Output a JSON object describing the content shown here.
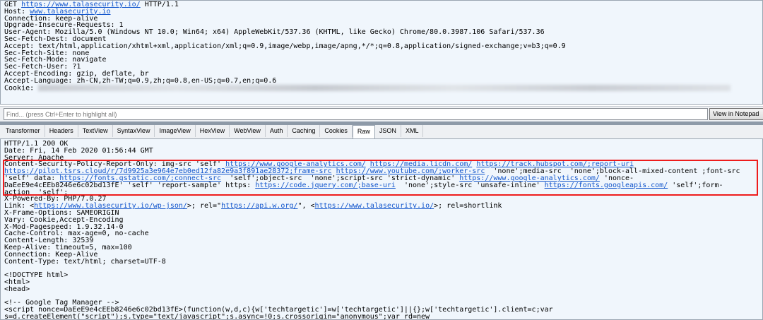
{
  "request": {
    "lines": [
      [
        {
          "t": "GET "
        },
        {
          "t": "https://www.talasecurity.io/",
          "link": true
        },
        {
          "t": " HTTP/1.1"
        }
      ],
      [
        {
          "t": "Host: "
        },
        {
          "t": "www.talasecurity.io",
          "link": true
        }
      ],
      [
        {
          "t": "Connection: keep-alive"
        }
      ],
      [
        {
          "t": "Upgrade-Insecure-Requests: 1"
        }
      ],
      [
        {
          "t": "User-Agent: Mozilla/5.0 (Windows NT 10.0; Win64; x64) AppleWebKit/537.36 (KHTML, like Gecko) Chrome/80.0.3987.106 Safari/537.36"
        }
      ],
      [
        {
          "t": "Sec-Fetch-Dest: document"
        }
      ],
      [
        {
          "t": "Accept: text/html,application/xhtml+xml,application/xml;q=0.9,image/webp,image/apng,*/*;q=0.8,application/signed-exchange;v=b3;q=0.9"
        }
      ],
      [
        {
          "t": "Sec-Fetch-Site: none"
        }
      ],
      [
        {
          "t": "Sec-Fetch-Mode: navigate"
        }
      ],
      [
        {
          "t": "Sec-Fetch-User: ?1"
        }
      ],
      [
        {
          "t": "Accept-Encoding: gzip, deflate, br"
        }
      ],
      [
        {
          "t": "Accept-Language: zh-CN,zh-TW;q=0.9,zh;q=0.8,en-US;q=0.7,en;q=0.6"
        }
      ],
      [
        {
          "t": "Cookie: "
        },
        {
          "blur": true
        }
      ]
    ]
  },
  "find": {
    "placeholder": "Find... (press Ctrl+Enter to highlight all)",
    "view_notepad": "View in Notepad"
  },
  "tabs": [
    "Transformer",
    "Headers",
    "TextView",
    "SyntaxView",
    "ImageView",
    "HexView",
    "WebView",
    "Auth",
    "Caching",
    "Cookies",
    "Raw",
    "JSON",
    "XML"
  ],
  "active_tab": "Raw",
  "response": {
    "lines": [
      [
        {
          "t": "HTTP/1.1 200 OK"
        }
      ],
      [
        {
          "t": "Date: Fri, 14 Feb 2020 01:56:44 GMT"
        }
      ],
      [
        {
          "t": "Server: Apache"
        }
      ],
      [
        {
          "t": "Content-Security-Policy-Report-Only: img-src 'self' "
        },
        {
          "t": "https://www.google-analytics.com/",
          "link": true
        },
        {
          "t": " "
        },
        {
          "t": "https://media.licdn.com/",
          "link": true
        },
        {
          "t": " "
        },
        {
          "t": "https://track.hubspot.com/;report-uri",
          "link": true
        }
      ],
      [
        {
          "t": "https://pilot.tsrs.cloud/r/7d9925a3e964e7eb0ed12fa82e9a3f891ae28372;frame-src",
          "link": true
        },
        {
          "t": " "
        },
        {
          "t": "https://www.youtube.com/;worker-src",
          "link": true
        },
        {
          "t": "  'none';media-src  'none';block-all-mixed-content ;font-src"
        }
      ],
      [
        {
          "t": "'self' data: "
        },
        {
          "t": "https://fonts.gstatic.com/;connect-src",
          "link": true
        },
        {
          "t": "  'self';object-src  'none';script-src 'strict-dynamic' "
        },
        {
          "t": "https://www.google-analytics.com/",
          "link": true
        },
        {
          "t": " 'nonce-"
        }
      ],
      [
        {
          "t": "DaEeE9e4cEEb8246e6c02bd13fE' 'self' 'report-sample' https: "
        },
        {
          "t": "https://code.jquery.com/;base-uri",
          "link": true
        },
        {
          "t": "  'none';style-src 'unsafe-inline' "
        },
        {
          "t": "https://fonts.googleapis.com/",
          "link": true
        },
        {
          "t": " 'self';form-"
        }
      ],
      [
        {
          "t": "action  'self';"
        }
      ],
      [
        {
          "t": "X-Powered-By: PHP/7.0.27"
        }
      ],
      [
        {
          "t": "Link: <"
        },
        {
          "t": "https://www.talasecurity.io/wp-json/",
          "link": true
        },
        {
          "t": ">; rel=\""
        },
        {
          "t": "https://api.w.org/",
          "link": true
        },
        {
          "t": "\", <"
        },
        {
          "t": "https://www.talasecurity.io/",
          "link": true
        },
        {
          "t": ">; rel=shortlink"
        }
      ],
      [
        {
          "t": "X-Frame-Options: SAMEORIGIN"
        }
      ],
      [
        {
          "t": "Vary: Cookie,Accept-Encoding"
        }
      ],
      [
        {
          "t": "X-Mod-Pagespeed: 1.9.32.14-0"
        }
      ],
      [
        {
          "t": "Cache-Control: max-age=0, no-cache"
        }
      ],
      [
        {
          "t": "Content-Length: 32539"
        }
      ],
      [
        {
          "t": "Keep-Alive: timeout=5, max=100"
        }
      ],
      [
        {
          "t": "Connection: Keep-Alive"
        }
      ],
      [
        {
          "t": "Content-Type: text/html; charset=UTF-8"
        }
      ],
      [
        {
          "t": ""
        }
      ],
      [
        {
          "t": "<!DOCTYPE html>"
        }
      ],
      [
        {
          "t": "<html>"
        }
      ],
      [
        {
          "t": "<head>"
        }
      ],
      [
        {
          "t": ""
        }
      ],
      [
        {
          "t": "<!-- Google Tag Manager -->"
        }
      ],
      [
        {
          "t": "<script nonce=DaEeE9e4cEEb8246e6c02bd13fE>(function(w,d,c){w['techtargetic']=w['techtargetic']||{};w['techtargetic'].client=c;var"
        }
      ],
      [
        {
          "t": "s=d.createElement(\"script\");s.type=\"text/javascript\";s.async=!0;s.crossorigin=\"anonymous\";var rd=new"
        }
      ]
    ]
  },
  "colors": {
    "link": "#1155cc",
    "highlight": "#ee1c1c",
    "pane": "#f0f6fc"
  }
}
